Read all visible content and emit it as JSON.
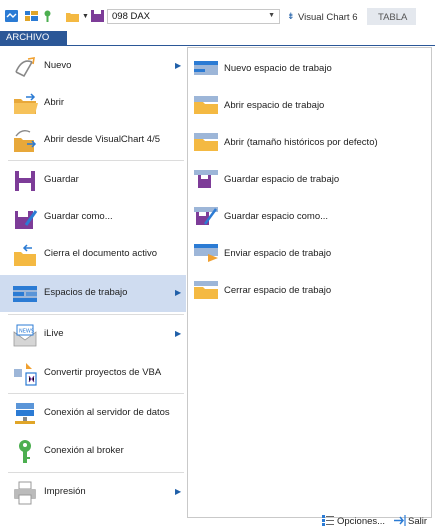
{
  "toolbar": {
    "symbol_value": "098 DAX",
    "chart_label": "Visual Chart 6",
    "tabla_label": "TABLA"
  },
  "file_tab": {
    "label": "ARCHIVO"
  },
  "menu": {
    "items": [
      {
        "label": "Nuevo",
        "icon": "new-icon",
        "has_submenu": true
      },
      {
        "label": "Abrir",
        "icon": "open-folder-icon",
        "has_submenu": false
      },
      {
        "label": "Abrir desde VisualChart 4/5",
        "icon": "open-from-vc-icon",
        "has_submenu": false
      },
      {
        "label": "Guardar",
        "icon": "save-icon",
        "has_submenu": false
      },
      {
        "label": "Guardar como...",
        "icon": "save-as-icon",
        "has_submenu": false
      },
      {
        "label": "Cierra el documento activo",
        "icon": "close-document-icon",
        "has_submenu": false
      },
      {
        "label": "Espacios de trabajo",
        "icon": "workspace-icon",
        "has_submenu": true,
        "selected": true
      },
      {
        "label": "iLive",
        "icon": "ilive-news-icon",
        "has_submenu": true
      },
      {
        "label": "Convertir proyectos de VBA",
        "icon": "vba-convert-icon",
        "has_submenu": false
      },
      {
        "label": "Conexión al servidor de datos",
        "icon": "data-server-icon",
        "has_submenu": false
      },
      {
        "label": "Conexión al broker",
        "icon": "broker-key-icon",
        "has_submenu": false
      },
      {
        "label": "Impresión",
        "icon": "printer-icon",
        "has_submenu": true
      }
    ]
  },
  "submenu": {
    "items": [
      {
        "label": "Nuevo espacio de trabajo",
        "icon": "new-workspace-icon"
      },
      {
        "label": "Abrir espacio de trabajo",
        "icon": "open-workspace-icon"
      },
      {
        "label": "Abrir (tamaño históricos por defecto)",
        "icon": "open-default-size-icon"
      },
      {
        "label": "Guardar espacio de trabajo",
        "icon": "save-workspace-icon"
      },
      {
        "label": "Guardar espacio como...",
        "icon": "save-workspace-as-icon"
      },
      {
        "label": "Enviar espacio de trabajo",
        "icon": "send-workspace-icon"
      },
      {
        "label": "Cerrar espacio de trabajo",
        "icon": "close-workspace-icon"
      }
    ]
  },
  "footer": {
    "options_label": "Opciones...",
    "exit_label": "Salir"
  },
  "colors": {
    "accent": "#2b5797",
    "selected_bg": "#cfdcf0",
    "chevron": "#1f5fa8"
  }
}
